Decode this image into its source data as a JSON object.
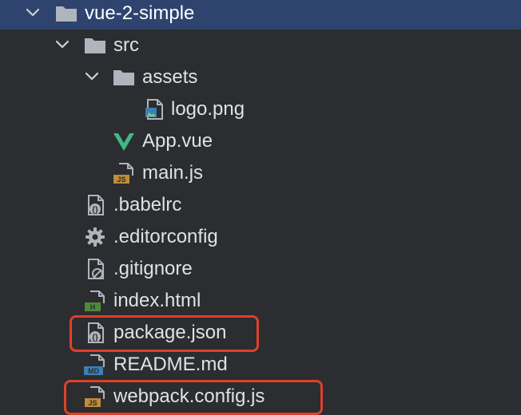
{
  "tree": {
    "root": {
      "label": "vue-2-simple",
      "icon": "folder-icon",
      "expanded": true,
      "selected": true
    },
    "src": {
      "label": "src",
      "icon": "folder-icon",
      "expanded": true
    },
    "assets": {
      "label": "assets",
      "icon": "folder-icon",
      "expanded": true
    },
    "logo": {
      "label": "logo.png",
      "icon": "image-file-icon"
    },
    "app_vue": {
      "label": "App.vue",
      "icon": "vue-file-icon"
    },
    "main_js": {
      "label": "main.js",
      "icon": "js-file-icon",
      "badge": "JS"
    },
    "babelrc": {
      "label": ".babelrc",
      "icon": "config-file-icon"
    },
    "editorconfig": {
      "label": ".editorconfig",
      "icon": "gear-icon"
    },
    "gitignore": {
      "label": ".gitignore",
      "icon": "ignore-file-icon"
    },
    "index_html": {
      "label": "index.html",
      "icon": "html-file-icon",
      "badge": "H"
    },
    "package_json": {
      "label": "package.json",
      "icon": "json-file-icon"
    },
    "readme": {
      "label": "README.md",
      "icon": "markdown-file-icon",
      "badge": "MD"
    },
    "webpack_config": {
      "label": "webpack.config.js",
      "icon": "js-file-icon",
      "badge": "JS"
    }
  },
  "colors": {
    "background": "#2b2d30",
    "selection": "#2e436e",
    "highlight_border": "#e0402a",
    "text": "#dfe1e5",
    "js_badge": "#c08c3a",
    "html_badge": "#4e8a3a",
    "md_badge": "#3d7fb5",
    "vue_green": "#41b883"
  }
}
